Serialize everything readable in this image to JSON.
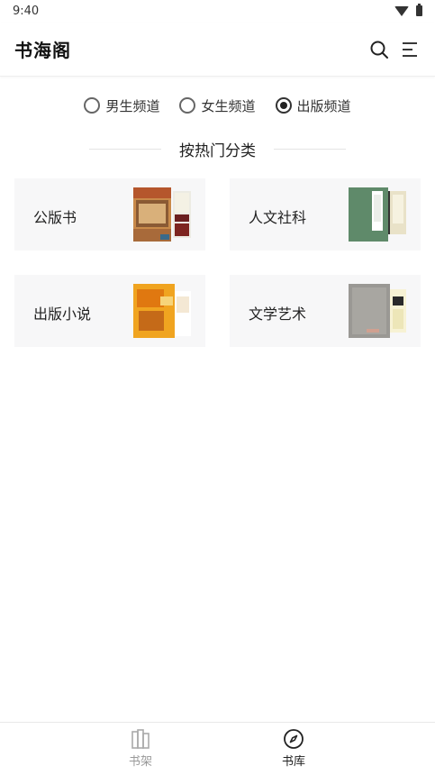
{
  "status_bar": {
    "time": "9:40"
  },
  "app_bar": {
    "title": "书海阁"
  },
  "channels": [
    {
      "label": "男生频道",
      "checked": false
    },
    {
      "label": "女生频道",
      "checked": false
    },
    {
      "label": "出版频道",
      "checked": true
    }
  ],
  "section": {
    "title": "按热门分类"
  },
  "categories": [
    {
      "name": "公版书"
    },
    {
      "name": "人文社科"
    },
    {
      "name": "出版小说"
    },
    {
      "name": "文学艺术"
    }
  ],
  "bottom_nav": {
    "shelf_label": "书架",
    "library_label": "书库"
  },
  "colors": {
    "accent": "#222222",
    "card_bg": "#f7f7f8",
    "inactive": "#999999"
  }
}
